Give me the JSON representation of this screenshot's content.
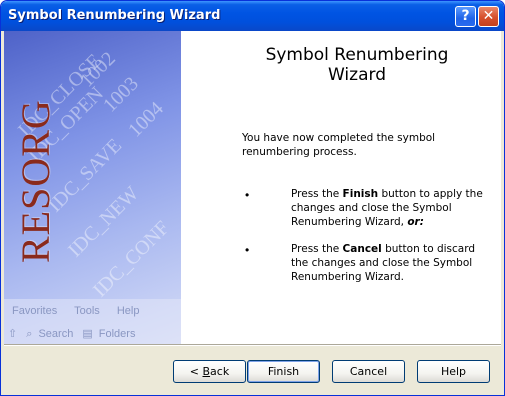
{
  "window": {
    "title": "Symbol Renumbering Wizard"
  },
  "titlebar_buttons": {
    "help": "?",
    "close": "✕"
  },
  "sidebar": {
    "brand": "RESORG",
    "watermark": [
      "IDC_OPEN",
      "IDC_CLOSE",
      "IDC_SAVE",
      "IDC_NEW",
      "IDC_CONF",
      "1002",
      "1003",
      "1004"
    ],
    "menu": [
      "Favorites",
      "Tools",
      "Help"
    ],
    "toolbar": [
      "Search",
      "Folders"
    ]
  },
  "content": {
    "heading": "Symbol Renumbering Wizard",
    "paragraph": "You have now completed the symbol renumbering process.",
    "bullets": [
      {
        "symbol": "•",
        "pre": "Press the ",
        "bold": "Finish",
        "post": " button to apply the changes and close the Symbol Renumbering Wizard, ",
        "tail": "or:"
      },
      {
        "symbol": "•",
        "pre": "Press the ",
        "bold": "Cancel",
        "post": " button to discard the changes and close the Symbol Renumbering Wizard.",
        "tail": ""
      }
    ]
  },
  "buttons": {
    "back_prefix": "< ",
    "back_key": "B",
    "back_rest": "ack",
    "finish": "Finish",
    "cancel": "Cancel",
    "help": "Help"
  }
}
